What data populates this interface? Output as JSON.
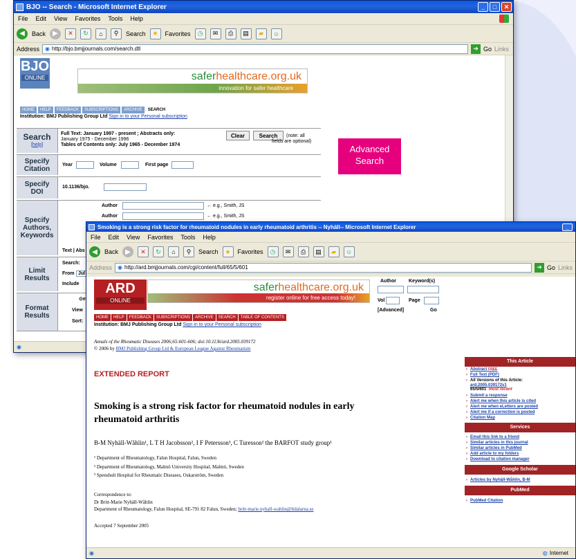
{
  "bjo_window": {
    "title": "BJO -- Search - Microsoft Internet Explorer",
    "menu": [
      "File",
      "Edit",
      "View",
      "Favorites",
      "Tools",
      "Help"
    ],
    "toolbar": {
      "back": "Back",
      "search": "Search",
      "favorites": "Favorites"
    },
    "address_label": "Address",
    "address": "http://bjo.bmjjournals.com/search.dtl",
    "go": "Go",
    "links": "Links",
    "logo_big": "BJO",
    "logo_small": "ONLINE",
    "banner_text_1": "safer",
    "banner_text_2": "healthcare.org.uk",
    "banner_tagline": "innovation for safer healthcare",
    "nav": [
      "HOME",
      "HELP",
      "FEEDBACK",
      "SUBSCRIPTIONS",
      "ARCHIVE",
      "SEARCH"
    ],
    "institution": "Institution: BMJ Publishing Group Ltd",
    "sign_in": "Sign in to your Personal subscription",
    "search_label": "Search",
    "help_label": "[help]",
    "search_info_1": "Full Text: January 1997 - present ; Abstracts only:",
    "search_info_2": "January 1975 - December 1996",
    "search_info_3": "Tables of Contents only: July 1965 - December 1974",
    "clear": "Clear",
    "search_btn": "Search",
    "note_1": "(note: all",
    "note_2": "fields are optional)",
    "citation_label_1": "Specify",
    "citation_label_2": "Citation",
    "year": "Year",
    "volume": "Volume",
    "first_page": "First page",
    "doi_label_1": "Specify",
    "doi_label_2": "DOI",
    "doi_prefix": "10.1136/bjo.",
    "authors_label_1": "Specify",
    "authors_label_2": "Authors,",
    "authors_label_3": "Keywords",
    "author": "Author",
    "author_example": "e.g., Smith, JS",
    "abs_label": "Ab",
    "text_abs": "Text | Abs",
    "limit_label_1": "Limit",
    "limit_label_2": "Results",
    "limit_search": "Search:",
    "limit_from": "From",
    "limit_jul": "Jul",
    "limit_include": "Include",
    "format_label_1": "Format",
    "format_label_2": "Results",
    "format_eta": "eta",
    "format_view": "View",
    "format_view_val": "10",
    "format_sort": "Sort:"
  },
  "advanced_search": {
    "line1": "Advanced",
    "line2": "Search",
    "color": "#e6007e"
  },
  "ard_window": {
    "title": "Smoking is a strong risk factor for rheumatoid nodules in early rheumatoid arthritis -- Nyhäll-- Microsoft Internet Explorer",
    "menu": [
      "File",
      "Edit",
      "View",
      "Favorites",
      "Tools",
      "Help"
    ],
    "address": "http://ard.bmjjournals.com/cgi/content/full/65/5/601",
    "logo_big": "ARD",
    "logo_small": "ONLINE",
    "banner_text_1": "safer",
    "banner_text_2": "healthcare.org.uk",
    "banner_tagline": "register online for free access today!",
    "search_author": "Author",
    "search_keywords": "Keyword(s)",
    "search_vol": "Vol",
    "search_page": "Page",
    "search_advanced": "[Advanced]",
    "search_go": "Go",
    "nav": [
      "HOME",
      "HELP",
      "FEEDBACK",
      "SUBSCRIPTIONS",
      "ARCHIVE",
      "SEARCH",
      "TABLE OF CONTENTS"
    ],
    "institution": "Institution: BMJ Publishing Group Ltd",
    "sign_in": "Sign in to your Personal subscription",
    "citation_1": "Annals of the Rheumatic Diseases 2006;65:601-606; doi:10.1136/ard.2005.039172",
    "citation_2": "© 2006 by",
    "citation_link": "BMJ Publishing Group Ltd & European League Against Rheumatism",
    "report_type": "EXTENDED REPORT",
    "article_title_1": "Smoking is a strong risk factor for rheumatoid nodules in early",
    "article_title_2": "rheumatoid arthritis",
    "authors": "B-M Nyhäll-Wåhlin¹, L T H Jacobsson², I F Petersson³, C Turesson² the BARFOT study group¹",
    "affiliations": [
      "¹ Department of Rheumatology, Falun Hospital, Falun, Sweden",
      "² Department of Rheumatology, Malmö University Hospital, Malmö, Sweden",
      "³ Spenshult Hospital for Rheumatic Diseases, Oskarström, Sweden"
    ],
    "correspondence_label": "Correspondence to:",
    "correspondence_name": "Dr Britt-Marie Nyhäll-Wåhlin",
    "correspondence_address": "Department of Rheumatology, Falun Hospital, SE-791 82 Falun, Sweden;",
    "correspondence_email": "britt-marie.nyhall-wahlin@ltdalarna.se",
    "accepted": "Accepted 7 September 2005",
    "status": "Internet",
    "sidebar": {
      "this_article": "This Article",
      "abstract": "Abstract",
      "free": "FREE",
      "full_text_pdf": "Full Text (PDF)",
      "all_versions": "All Versions of this Article:",
      "version_id": "ard.2005.039172v1",
      "version_cur": "65/5/601",
      "most_recent": "most recent",
      "items_1": [
        "Submit a response",
        "Alert me when this article is cited",
        "Alert me when eLetters are posted",
        "Alert me if a correction is posted",
        "Citation Map"
      ],
      "services": "Services",
      "items_2": [
        "Email this link to a friend",
        "Similar articles in this journal",
        "Similar articles in PubMed",
        "Add article to my folders",
        "Download to citation manager"
      ],
      "google_scholar": "Google Scholar",
      "scholar_item": "Articles by Nyhäll-Wåhlin, B-M",
      "pubmed": "PubMed",
      "pubmed_item": "PubMed Citation"
    }
  }
}
